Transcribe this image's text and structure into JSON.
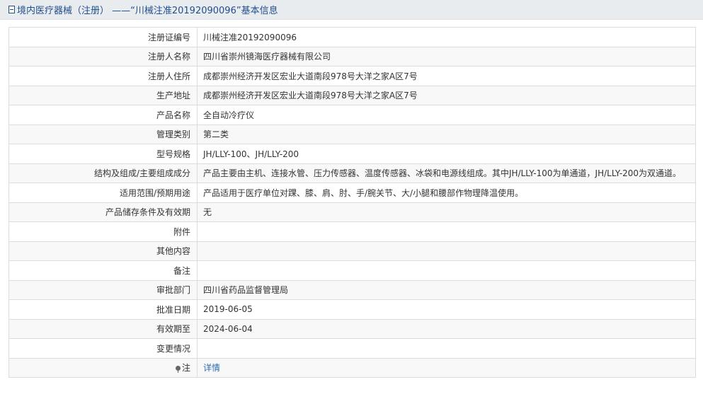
{
  "header": {
    "icon": "document-icon",
    "title": "境内医疗器械（注册） ——“川械注准20192090096”基本信息"
  },
  "rows": [
    {
      "label": "注册证编号",
      "value": "川械注准20192090096"
    },
    {
      "label": "注册人名称",
      "value": "四川省崇州镜海医疗器械有限公司"
    },
    {
      "label": "注册人住所",
      "value": "成都崇州经济开发区宏业大道南段978号大洋之家A区7号"
    },
    {
      "label": "生产地址",
      "value": "成都崇州经济开发区宏业大道南段978号大洋之家A区7号"
    },
    {
      "label": "产品名称",
      "value": "全自动冷疗仪"
    },
    {
      "label": "管理类别",
      "value": "第二类"
    },
    {
      "label": "型号规格",
      "value": "JH/LLY-100、JH/LLY-200"
    },
    {
      "label": "结构及组成/主要组成成分",
      "value": "产品主要由主机、连接水管、压力传感器、温度传感器、冰袋和电源线组成。其中JH/LLY-100为单通道，JH/LLY-200为双通道。"
    },
    {
      "label": "适用范围/预期用途",
      "value": "产品适用于医疗单位对踝、膝、肩、肘、手/腕关节、大/小腿和腰部作物理降温使用。"
    },
    {
      "label": "产品储存条件及有效期",
      "value": "无"
    },
    {
      "label": "附件",
      "value": ""
    },
    {
      "label": "其他内容",
      "value": ""
    },
    {
      "label": "备注",
      "value": ""
    },
    {
      "label": "审批部门",
      "value": "四川省药品监督管理局"
    },
    {
      "label": "批准日期",
      "value": "2019-06-05"
    },
    {
      "label": "有效期至",
      "value": "2024-06-04"
    },
    {
      "label": "变更情况",
      "value": ""
    }
  ],
  "note_row": {
    "icon": "pin-icon",
    "label": "注",
    "link": "详情"
  }
}
